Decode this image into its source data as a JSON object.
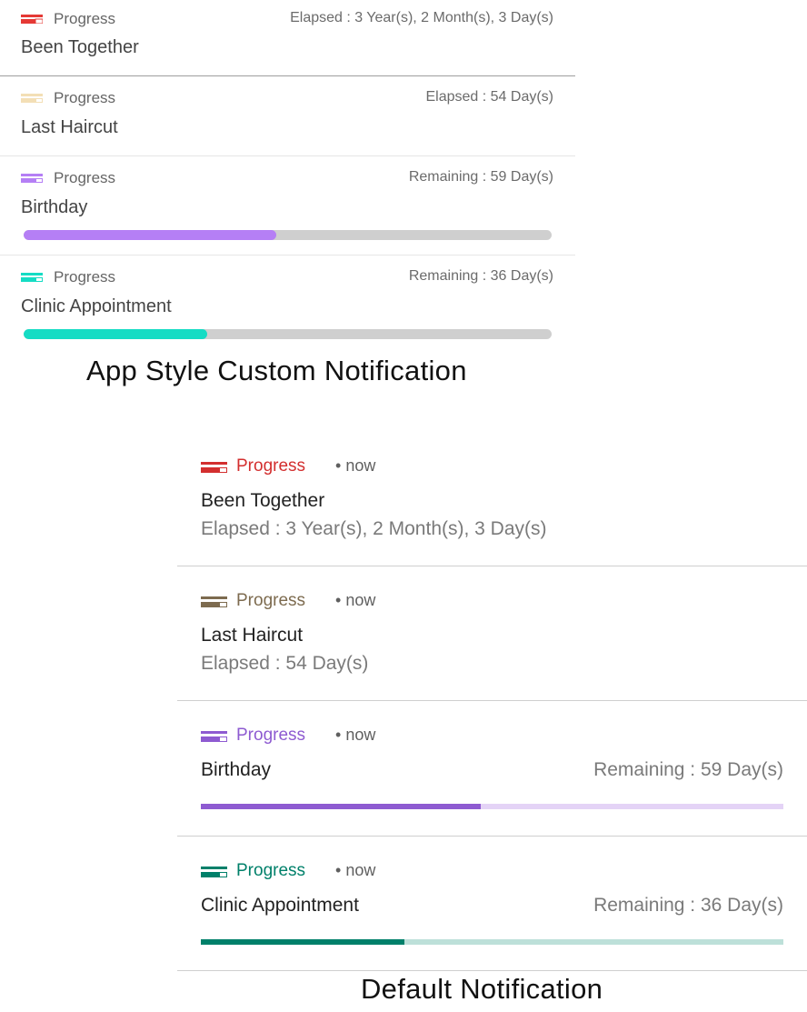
{
  "app_style": {
    "items": [
      {
        "app": "Progress",
        "title": "Been Together",
        "status": "Elapsed : 3 Year(s), 2 Month(s), 3 Day(s)",
        "color": "#e53935"
      },
      {
        "app": "Progress",
        "title": "Last Haircut",
        "status": "Elapsed : 54 Day(s)",
        "color": "#f3dfb6"
      },
      {
        "app": "Progress",
        "title": "Birthday",
        "status": "Remaining : 59 Day(s)",
        "color": "#b57ff5",
        "progress": 0.478
      },
      {
        "app": "Progress",
        "title": "Clinic Appointment",
        "status": "Remaining : 36 Day(s)",
        "color": "#15dcc4",
        "progress": 0.348
      }
    ],
    "caption": "App Style Custom Notification"
  },
  "default_style": {
    "items": [
      {
        "app": "Progress",
        "time": "now",
        "title": "Been Together",
        "subtitle": "Elapsed : 3 Year(s), 2 Month(s), 3 Day(s)",
        "color": "#d32f2f"
      },
      {
        "app": "Progress",
        "time": "now",
        "title": "Last Haircut",
        "subtitle": "Elapsed : 54 Day(s)",
        "color": "#7d6b4f"
      },
      {
        "app": "Progress",
        "time": "now",
        "title": "Birthday",
        "status": "Remaining : 59 Day(s)",
        "color": "#8e5bd1",
        "track_color": "#e4d3f6",
        "progress": 0.48
      },
      {
        "app": "Progress",
        "time": "now",
        "title": "Clinic Appointment",
        "status": "Remaining : 36 Day(s)",
        "color": "#00806a",
        "track_color": "#bde0d9",
        "progress": 0.35
      }
    ],
    "dot": "•",
    "caption": "Default Notification"
  }
}
